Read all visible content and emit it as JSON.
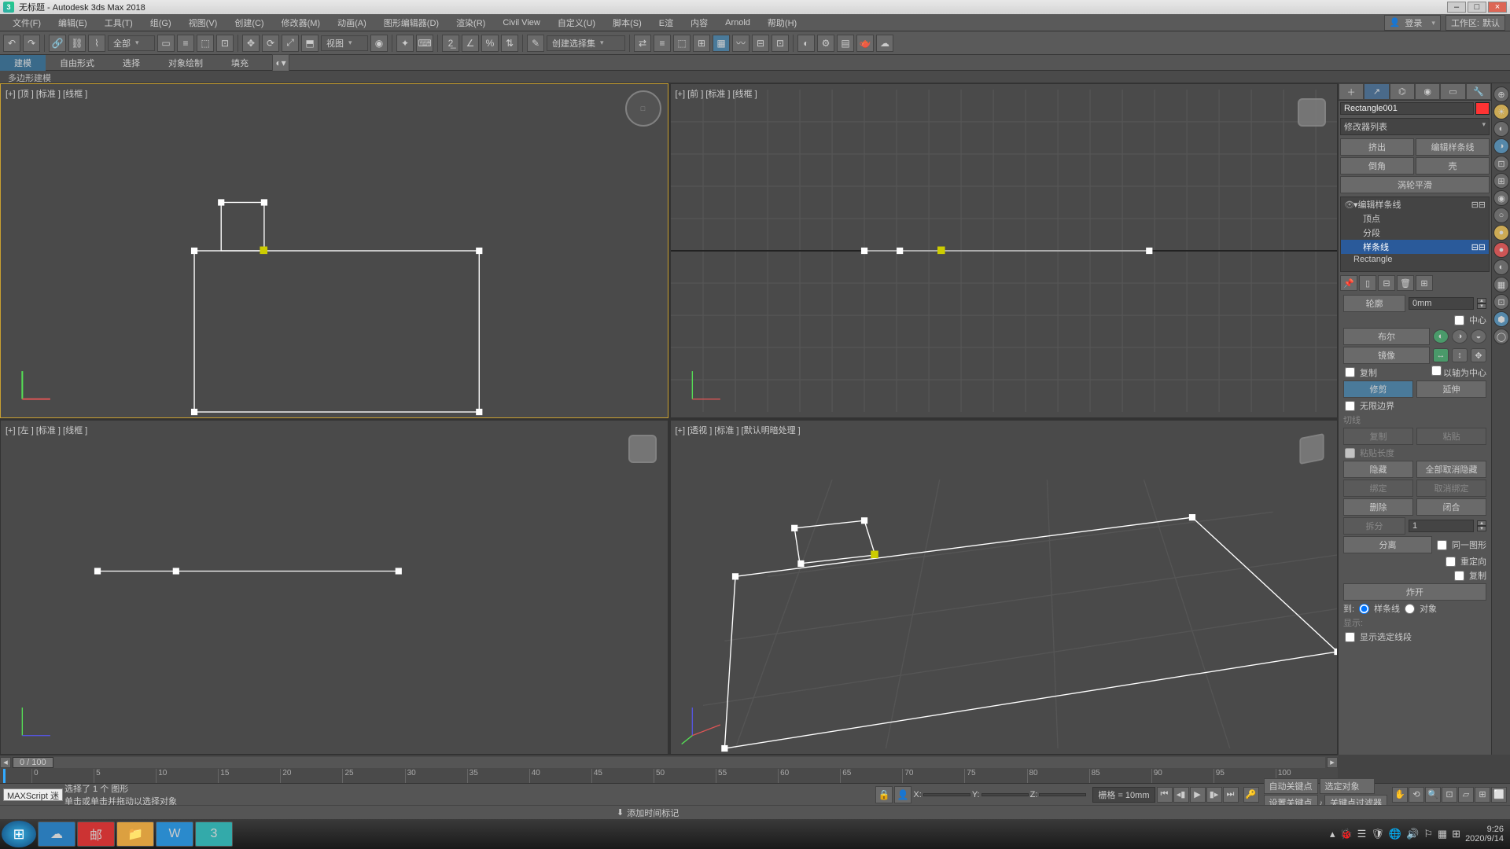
{
  "title": "无标题 - Autodesk 3ds Max 2018",
  "menubar": {
    "items": [
      "文件(F)",
      "编辑(E)",
      "工具(T)",
      "组(G)",
      "视图(V)",
      "创建(C)",
      "修改器(M)",
      "动画(A)",
      "图形编辑器(D)",
      "渲染(R)",
      "Civil View",
      "自定义(U)",
      "脚本(S)",
      "E渲",
      "内容",
      "Arnold",
      "帮助(H)"
    ],
    "login_label": "登录",
    "workspace_label": "工作区:",
    "workspace_value": "默认"
  },
  "toolbar": {
    "selset_label": "全部",
    "view_label": "视图",
    "createselset_label": "创建选择集"
  },
  "ribbon": {
    "tabs": [
      "建模",
      "自由形式",
      "选择",
      "对象绘制",
      "填充"
    ],
    "subtab": "多边形建模"
  },
  "viewports": {
    "top": "[+] [顶 ] [标准 ] [线框 ]",
    "front": "[+] [前 ] [标准 ] [线框 ]",
    "left": "[+] [左 ] [标准 ] [线框 ]",
    "persp": "[+] [透视 ] [标准 ] [默认明暗处理 ]"
  },
  "cmdpanel": {
    "object_name": "Rectangle001",
    "modlist_label": "修改器列表",
    "btn_extrude": "挤出",
    "btn_editspline": "编辑样条线",
    "btn_chamfer": "倒角",
    "btn_shell": "壳",
    "btn_turbosmooth": "涡轮平滑",
    "stack": {
      "mod": "编辑样条线",
      "sub_vertex": "顶点",
      "sub_segment": "分段",
      "sub_spline": "样条线",
      "base": "Rectangle"
    },
    "roll": {
      "outline_lbl": "轮廓",
      "outline_val": "0mm",
      "center_lbl": "中心",
      "bool_lbl": "布尔",
      "mirror_lbl": "镜像",
      "copy_lbl": "复制",
      "axis_lbl": "以轴为中心",
      "trim_lbl": "修剪",
      "extend_lbl": "延伸",
      "infinite_lbl": "无限边界",
      "tangent_lbl": "切线",
      "copy2_lbl": "复制",
      "paste_lbl": "粘贴",
      "pastelen_lbl": "粘贴长度",
      "hide_lbl": "隐藏",
      "unhideall_lbl": "全部取消隐藏",
      "bind_lbl": "绑定",
      "unbind_lbl": "取消绑定",
      "delete_lbl": "删除",
      "close_lbl": "闭合",
      "divide_lbl": "拆分",
      "divide_val": "1",
      "detach_lbl": "分离",
      "sameshp_lbl": "同一图形",
      "reorient_lbl": "重定向",
      "copy3_lbl": "复制",
      "explode_lbl": "炸开",
      "to_lbl": "到:",
      "tospline_lbl": "样条线",
      "toobject_lbl": "对象",
      "display_lbl": "显示:",
      "showsel_lbl": "显示选定线段"
    }
  },
  "time": {
    "frame_display": "0  /  100",
    "ruler_ticks": [
      "0",
      "5",
      "10",
      "15",
      "20",
      "25",
      "30",
      "35",
      "40",
      "45",
      "50",
      "55",
      "60",
      "65",
      "70",
      "75",
      "80",
      "85",
      "90",
      "95",
      "100"
    ]
  },
  "status": {
    "maxscript": "MAXScript 迷",
    "sel_text": "选择了 1 个 图形",
    "hint_text": "单击或单击并拖动以选择对象",
    "x_lbl": "X:",
    "y_lbl": "Y:",
    "z_lbl": "Z:",
    "grid_label": "栅格 = 10mm",
    "addtimemark": "添加时间标记",
    "autokey": "自动关键点",
    "selset": "选定对象",
    "setkey": "设置关键点",
    "keyfilter": "关键点过滤器"
  },
  "tray": {
    "time": "9:26",
    "date": "2020/9/14"
  }
}
